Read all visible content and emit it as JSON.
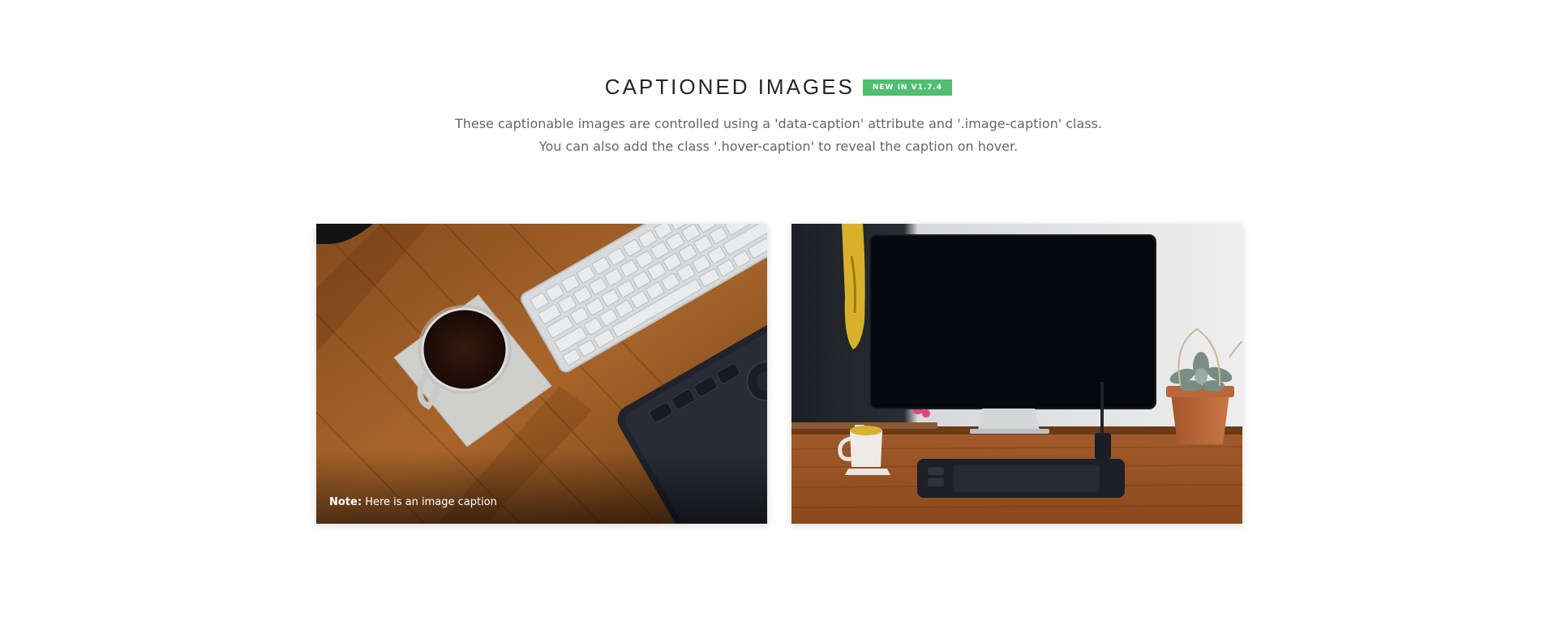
{
  "header": {
    "title": "CAPTIONED IMAGES",
    "badge": "NEW IN V1.7.4",
    "desc_line1": "These captionable images are controlled using a 'data-caption' attribute and '.image-caption' class.",
    "desc_line2": "You can also add the class '.hover-caption' to reveal the caption on hover."
  },
  "images": [
    {
      "scene": "desk-coffee-keyboard-tablet",
      "caption_label": "Note:",
      "caption_text": "Here is an image caption"
    },
    {
      "scene": "desk-monitor-mug-plant"
    }
  ],
  "colors": {
    "badge": "#4ebf71",
    "title": "#252525",
    "text": "#666666"
  }
}
